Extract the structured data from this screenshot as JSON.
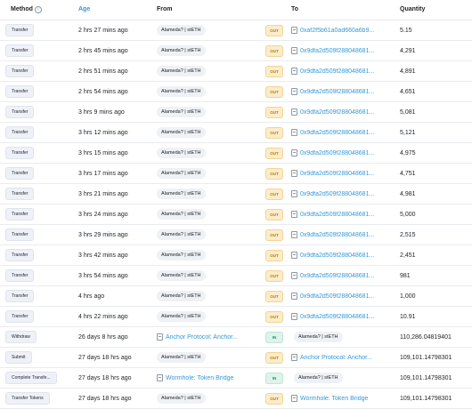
{
  "header": {
    "method": "Method",
    "age": "Age",
    "from": "From",
    "to": "To",
    "quantity": "Quantity",
    "info_icon_glyph": "i"
  },
  "rows": [
    {
      "method": "Transfer",
      "age": "2 hrs 27 mins ago",
      "from": "Alameda? | stETH",
      "from_kind": "pill",
      "dir": "OUT",
      "to": "0xaf2f5b61a0ad660a6b9...",
      "to_kind": "link",
      "qty": "5.15"
    },
    {
      "method": "Transfer",
      "age": "2 hrs 45 mins ago",
      "from": "Alameda? | stETH",
      "from_kind": "pill",
      "dir": "OUT",
      "to": "0x9dfa2d509f288048681...",
      "to_kind": "link",
      "qty": "4,291"
    },
    {
      "method": "Transfer",
      "age": "2 hrs 51 mins ago",
      "from": "Alameda? | stETH",
      "from_kind": "pill",
      "dir": "OUT",
      "to": "0x9dfa2d509f288048681...",
      "to_kind": "link",
      "qty": "4,891"
    },
    {
      "method": "Transfer",
      "age": "2 hrs 54 mins ago",
      "from": "Alameda? | stETH",
      "from_kind": "pill",
      "dir": "OUT",
      "to": "0x9dfa2d509f288048681...",
      "to_kind": "link",
      "qty": "4,651"
    },
    {
      "method": "Transfer",
      "age": "3 hrs 9 mins ago",
      "from": "Alameda? | stETH",
      "from_kind": "pill",
      "dir": "OUT",
      "to": "0x9dfa2d509f288048681...",
      "to_kind": "link",
      "qty": "5,081"
    },
    {
      "method": "Transfer",
      "age": "3 hrs 12 mins ago",
      "from": "Alameda? | stETH",
      "from_kind": "pill",
      "dir": "OUT",
      "to": "0x9dfa2d509f288048681...",
      "to_kind": "link",
      "qty": "5,121"
    },
    {
      "method": "Transfer",
      "age": "3 hrs 15 mins ago",
      "from": "Alameda? | stETH",
      "from_kind": "pill",
      "dir": "OUT",
      "to": "0x9dfa2d509f288048681...",
      "to_kind": "link",
      "qty": "4,975"
    },
    {
      "method": "Transfer",
      "age": "3 hrs 17 mins ago",
      "from": "Alameda? | stETH",
      "from_kind": "pill",
      "dir": "OUT",
      "to": "0x9dfa2d509f288048681...",
      "to_kind": "link",
      "qty": "4,751"
    },
    {
      "method": "Transfer",
      "age": "3 hrs 21 mins ago",
      "from": "Alameda? | stETH",
      "from_kind": "pill",
      "dir": "OUT",
      "to": "0x9dfa2d509f288048681...",
      "to_kind": "link",
      "qty": "4,981"
    },
    {
      "method": "Transfer",
      "age": "3 hrs 24 mins ago",
      "from": "Alameda? | stETH",
      "from_kind": "pill",
      "dir": "OUT",
      "to": "0x9dfa2d509f288048681...",
      "to_kind": "link",
      "qty": "5,000"
    },
    {
      "method": "Transfer",
      "age": "3 hrs 29 mins ago",
      "from": "Alameda? | stETH",
      "from_kind": "pill",
      "dir": "OUT",
      "to": "0x9dfa2d509f288048681...",
      "to_kind": "link",
      "qty": "2,515"
    },
    {
      "method": "Transfer",
      "age": "3 hrs 42 mins ago",
      "from": "Alameda? | stETH",
      "from_kind": "pill",
      "dir": "OUT",
      "to": "0x9dfa2d509f288048681...",
      "to_kind": "link",
      "qty": "2,451"
    },
    {
      "method": "Transfer",
      "age": "3 hrs 54 mins ago",
      "from": "Alameda? | stETH",
      "from_kind": "pill",
      "dir": "OUT",
      "to": "0x9dfa2d509f288048681...",
      "to_kind": "link",
      "qty": "981"
    },
    {
      "method": "Transfer",
      "age": "4 hrs ago",
      "from": "Alameda? | stETH",
      "from_kind": "pill",
      "dir": "OUT",
      "to": "0x9dfa2d509f288048681...",
      "to_kind": "link",
      "qty": "1,000"
    },
    {
      "method": "Transfer",
      "age": "4 hrs 22 mins ago",
      "from": "Alameda? | stETH",
      "from_kind": "pill",
      "dir": "OUT",
      "to": "0x9dfa2d509f288048681...",
      "to_kind": "link",
      "qty": "10.91"
    },
    {
      "method": "Withdraw",
      "age": "26 days 8 hrs ago",
      "from": "Anchor Protocol: Anchor...",
      "from_kind": "doc-link",
      "dir": "IN",
      "to": "Alameda? | stETH",
      "to_kind": "pill",
      "qty": "110,286.04819401"
    },
    {
      "method": "Submit",
      "age": "27 days 18 hrs ago",
      "from": "Alameda? | stETH",
      "from_kind": "pill",
      "dir": "OUT",
      "to": "Anchor Protocol: Anchor...",
      "to_kind": "doc-link",
      "qty": "109,101.14798301"
    },
    {
      "method": "Complete Transfe...",
      "age": "27 days 18 hrs ago",
      "from": "Wormhole: Token Bridge",
      "from_kind": "doc-link",
      "dir": "IN",
      "to": "Alameda? | stETH",
      "to_kind": "pill",
      "qty": "109,101.14798301"
    },
    {
      "method": "Transfer Tokens",
      "age": "27 days 18 hrs ago",
      "from": "Alameda? | stETH",
      "from_kind": "pill",
      "dir": "OUT",
      "to": "Wormhole: Token Bridge",
      "to_kind": "doc-link",
      "qty": "109,101.14798301"
    }
  ]
}
